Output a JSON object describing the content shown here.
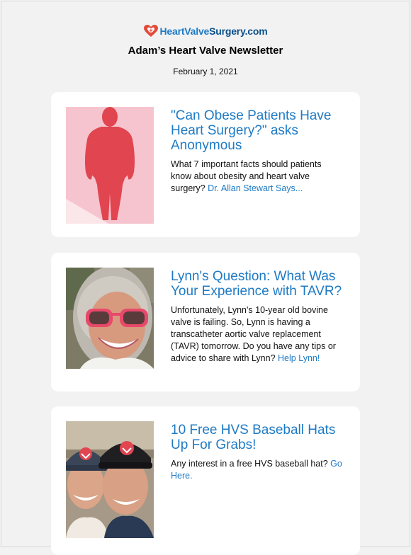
{
  "brand": {
    "name_part1": "HeartValve",
    "name_part2": "Surgery.com",
    "logo_icon": "heart-valve-logo-icon",
    "colors": {
      "primary": "#1e7ac4",
      "dark": "#0a4f8a",
      "heart": "#e24a3b"
    }
  },
  "newsletter": {
    "title": "Adam’s Heart Valve Newsletter",
    "date": "February 1, 2021"
  },
  "articles": [
    {
      "headline": "\"Can Obese Patients Have Heart Surgery?\" asks Anonymous",
      "summary": "What 7 important facts should patients know about obesity and heart valve surgery?",
      "link_text": "Dr. Allan Stewart Says...",
      "image": "obese-silhouette-illustration"
    },
    {
      "headline": "Lynn's Question: What Was Your Experience with TAVR?",
      "summary": "Unfortunately, Lynn's 10-year old bovine valve is failing. So, Lynn is having a transcatheter aortic valve replacement (TAVR) tomorrow.  Do you have any tips or advice to share with Lynn?",
      "link_text": "Help Lynn!",
      "image": "smiling-woman-photo"
    },
    {
      "headline": "10 Free HVS Baseball Hats Up For Grabs!",
      "summary": "Any interest in a free HVS baseball hat?",
      "link_text": "Go Here.",
      "image": "couple-in-hats-photo"
    }
  ]
}
